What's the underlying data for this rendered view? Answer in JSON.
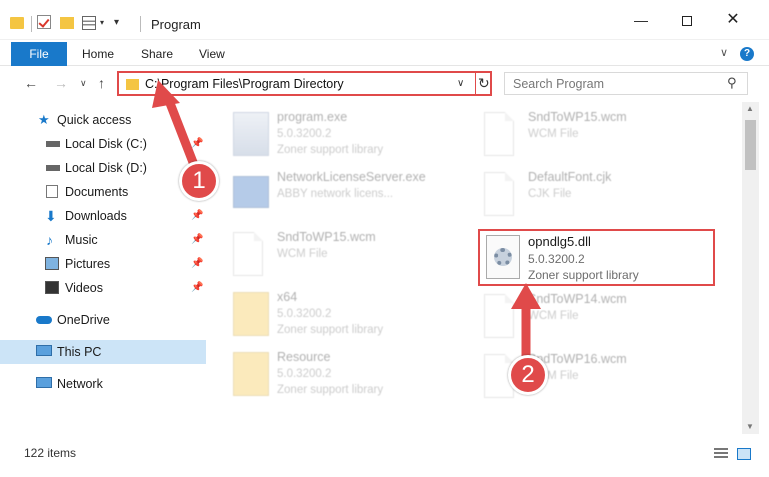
{
  "window": {
    "title": "Program"
  },
  "ribbon": {
    "file": "File",
    "tabs": [
      "Home",
      "Share",
      "View"
    ],
    "help": "?"
  },
  "nav": {
    "address": "C:\\Program Files\\Program Directory",
    "search_placeholder": "Search Program"
  },
  "sidebar": {
    "items": [
      {
        "label": "Quick access",
        "icon": "star-icon",
        "pinned": false
      },
      {
        "label": "Local Disk (C:)",
        "icon": "drive-icon",
        "pinned": true
      },
      {
        "label": "Local Disk (D:)",
        "icon": "drive-icon",
        "pinned": false
      },
      {
        "label": "Documents",
        "icon": "documents-icon",
        "pinned": false
      },
      {
        "label": "Downloads",
        "icon": "download-icon",
        "pinned": true
      },
      {
        "label": "Music",
        "icon": "music-icon",
        "pinned": true
      },
      {
        "label": "Pictures",
        "icon": "pictures-icon",
        "pinned": true
      },
      {
        "label": "Videos",
        "icon": "videos-icon",
        "pinned": true
      },
      {
        "label": "OneDrive",
        "icon": "cloud-icon",
        "pinned": false
      },
      {
        "label": "This PC",
        "icon": "pc-icon",
        "pinned": false,
        "selected": true
      },
      {
        "label": "Network",
        "icon": "network-icon",
        "pinned": false
      }
    ]
  },
  "files": {
    "left": [
      {
        "name": "program.exe",
        "meta1": "5.0.3200.2",
        "meta2": "Zoner support library",
        "icon": "exe-icon"
      },
      {
        "name": "NetworkLicenseServer.exe",
        "meta1": "ABBY network licens...",
        "meta2": "",
        "icon": "window-icon"
      },
      {
        "name": "SndToWP15.wcm",
        "meta1": "WCM File",
        "meta2": "",
        "icon": "document-icon"
      },
      {
        "name": "x64",
        "meta1": "5.0.3200.2",
        "meta2": "Zoner support library",
        "icon": "folder-icon"
      },
      {
        "name": "Resource",
        "meta1": "5.0.3200.2",
        "meta2": "Zoner support library",
        "icon": "folder-icon"
      }
    ],
    "right": [
      {
        "name": "SndToWP15.wcm",
        "meta1": "WCM File",
        "meta2": "",
        "icon": "document-icon"
      },
      {
        "name": "DefaultFont.cjk",
        "meta1": "CJK File",
        "meta2": "",
        "icon": "document-icon"
      },
      {
        "name": "SndToWP14.wcm",
        "meta1": "WCM File",
        "meta2": "",
        "icon": "document-icon"
      },
      {
        "name": "SndToWP16.wcm",
        "meta1": "WCM File",
        "meta2": "",
        "icon": "document-icon"
      }
    ],
    "highlighted": {
      "name": "opndlg5.dll",
      "meta1": "5.0.3200.2",
      "meta2": "Zoner support library",
      "icon": "dll-gear-icon"
    }
  },
  "status": {
    "items": "122 items"
  },
  "annotations": {
    "step1": "1",
    "step2": "2",
    "color": "#e04a4a"
  }
}
